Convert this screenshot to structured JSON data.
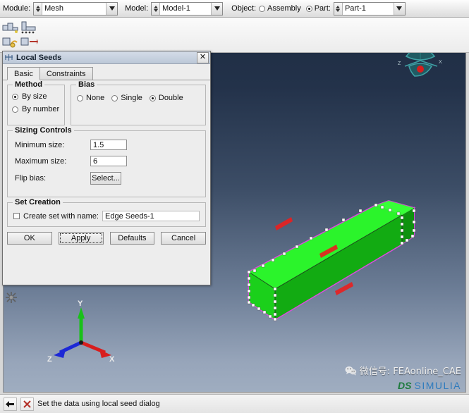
{
  "context_bar": {
    "module": {
      "label": "Module:",
      "value": "Mesh",
      "icon": "spinner-combo-icon"
    },
    "model": {
      "label": "Model:",
      "value": "Model-1",
      "icon": "spinner-combo-icon"
    },
    "object": {
      "label": "Object:",
      "options": [
        {
          "label": "Assembly",
          "selected": false
        },
        {
          "label": "Part:",
          "selected": true
        }
      ],
      "part_value": "Part-1"
    }
  },
  "toolbar": {
    "name": "mesh-toolbar",
    "icons": [
      "seed-part-icon",
      "seed-edges-icon",
      "assign-mesh-controls-icon",
      "mesh-part-icon"
    ]
  },
  "dialog": {
    "title": "Local Seeds",
    "title_icon": "local-seeds-icon",
    "close_label": "✕",
    "tabs": [
      {
        "label": "Basic",
        "active": true
      },
      {
        "label": "Constraints",
        "active": false
      }
    ],
    "method": {
      "legend": "Method",
      "options": [
        {
          "label": "By size",
          "selected": true
        },
        {
          "label": "By number",
          "selected": false
        }
      ]
    },
    "bias": {
      "legend": "Bias",
      "options": [
        {
          "label": "None",
          "selected": false
        },
        {
          "label": "Single",
          "selected": false
        },
        {
          "label": "Double",
          "selected": true
        }
      ]
    },
    "sizing_controls": {
      "legend": "Sizing Controls",
      "minimum_size": {
        "label": "Minimum size:",
        "value": "1.5"
      },
      "maximum_size": {
        "label": "Maximum size:",
        "value": "6"
      },
      "flip_bias": {
        "label": "Flip bias:",
        "button_label": "Select..."
      }
    },
    "set_creation": {
      "legend": "Set Creation",
      "checkbox_label": "Create set with name:",
      "checked": false,
      "set_name": "Edge Seeds-1"
    },
    "buttons": [
      {
        "label": "OK",
        "focused": false
      },
      {
        "label": "Apply",
        "focused": true
      },
      {
        "label": "Defaults",
        "focused": false
      },
      {
        "label": "Cancel",
        "focused": false
      }
    ]
  },
  "viewport": {
    "triad": {
      "x_label": "X",
      "y_label": "Y",
      "z_label": "Z",
      "x_color": "#d81d1d",
      "y_color": "#19c119",
      "z_color": "#1c28d6"
    },
    "view_widget": {
      "name": "view-manipulation-widget",
      "color": "#2e8f92"
    },
    "model": {
      "name": "beam-part",
      "face_color": "#1fe01f",
      "highlight_edge_color": "#e04ce0",
      "seed_node_color": "#ffffff",
      "bias_arrow_color": "#e82020"
    },
    "background_top": "#1e2c42",
    "background_bottom": "#9fadc0"
  },
  "status_bar": {
    "back_icon": "back-arrow-icon",
    "cancel_icon": "cancel-x-icon",
    "message": "Set the data using local seed dialog"
  },
  "watermark": {
    "wechat_icon": "wechat-icon",
    "text": "微信号: FEAonline_CAE",
    "brand_prefix": "DS",
    "brand_name": "SIMULIA"
  }
}
